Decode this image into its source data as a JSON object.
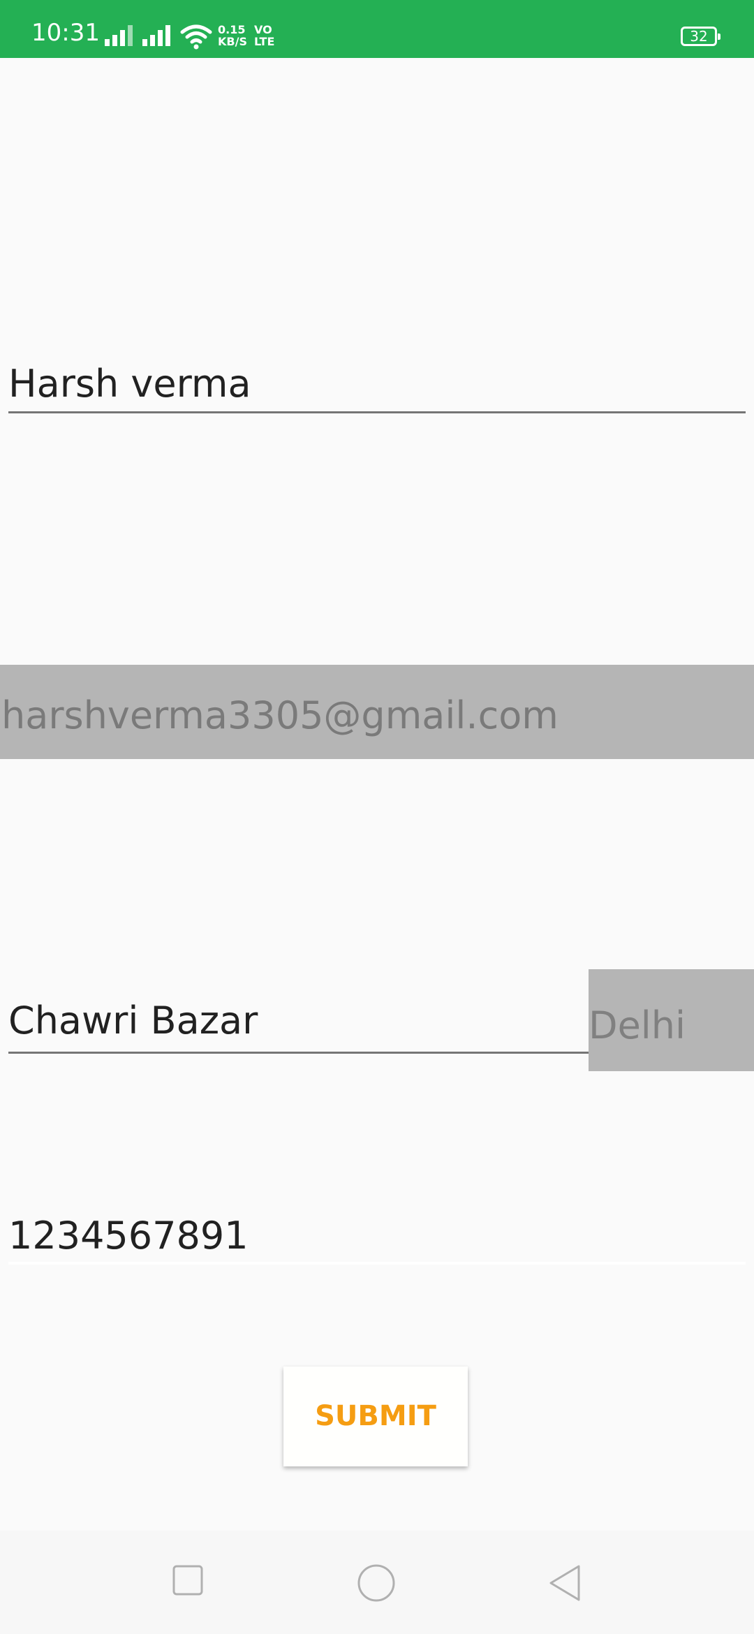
{
  "status_bar": {
    "time": "10:31",
    "net_speed_value": "0.15",
    "net_speed_unit": "KB/S",
    "volte_line1": "VO",
    "volte_line2": "LTE",
    "battery_level": "32",
    "icons": [
      "signal-icon",
      "signal-icon",
      "wifi-icon",
      "battery-icon"
    ],
    "color": "#24b054"
  },
  "form": {
    "name_value": "Harsh verma",
    "email_value": "harshverma3305@gmail.com",
    "address_value": "Chawri Bazar",
    "city_value": "Delhi",
    "phone_value": "1234567891",
    "submit_label": "SUBMIT",
    "submit_color": "#f59d12"
  },
  "nav_bar": {
    "buttons": [
      "recents-square-icon",
      "home-circle-icon",
      "back-triangle-icon"
    ]
  }
}
